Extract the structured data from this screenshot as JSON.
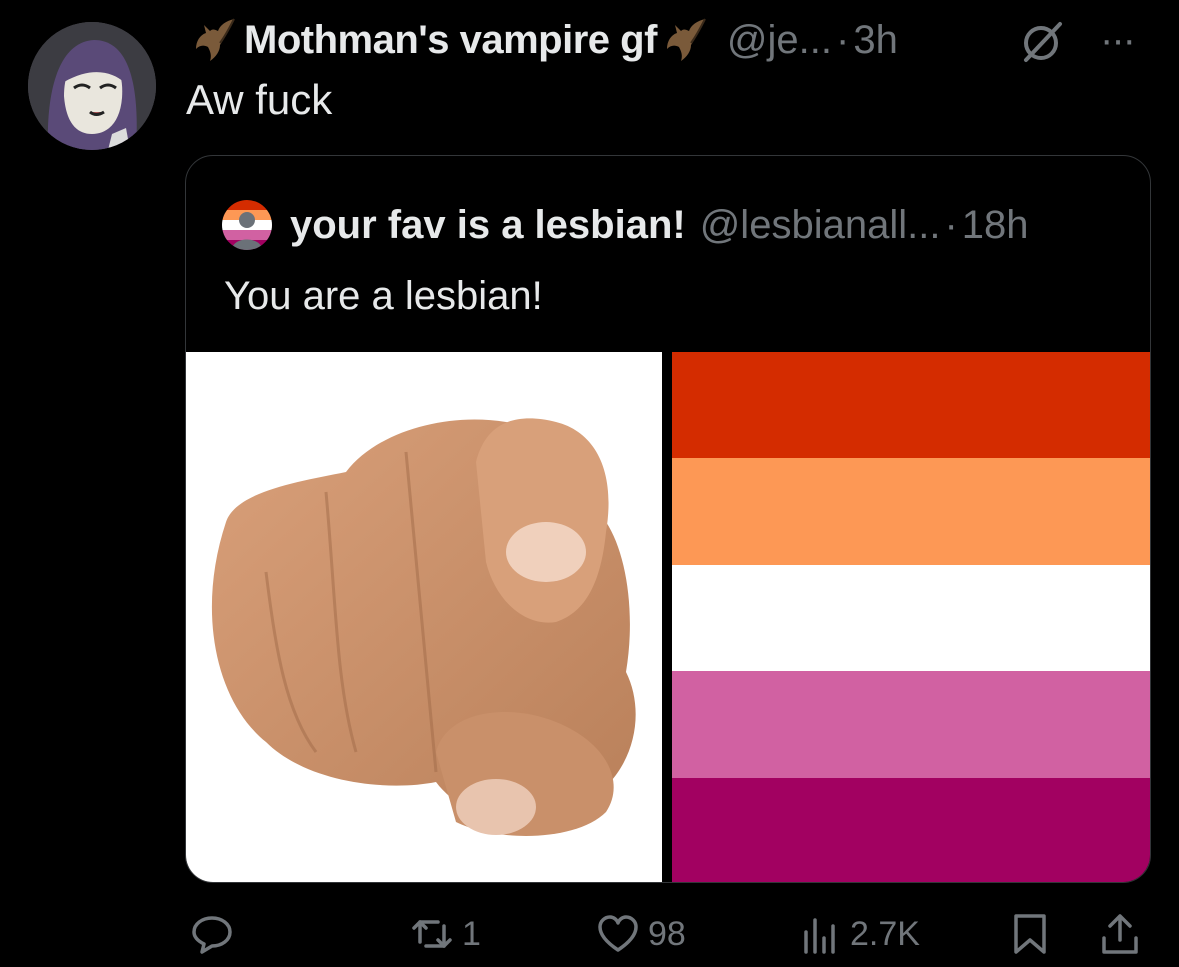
{
  "tweet": {
    "display_name": "Mothman's vampire gf",
    "handle": "@je...",
    "separator": "·",
    "time": "3h",
    "more_label": "···",
    "text": "Aw fuck"
  },
  "quote": {
    "display_name": "your fav is a lesbian!",
    "handle": "@lesbianall...",
    "separator": "·",
    "time": "18h",
    "text": "You are a lesbian!",
    "flag_colors": [
      "#d42c00",
      "#fd9855",
      "#ffffff",
      "#d161a2",
      "#a20161"
    ]
  },
  "actions": {
    "replies": "",
    "retweets": "1",
    "likes": "98",
    "views": "2.7K"
  },
  "colors": {
    "background": "#000000",
    "text_primary": "#e7e9ea",
    "text_secondary": "#71767b",
    "border": "#333639"
  }
}
